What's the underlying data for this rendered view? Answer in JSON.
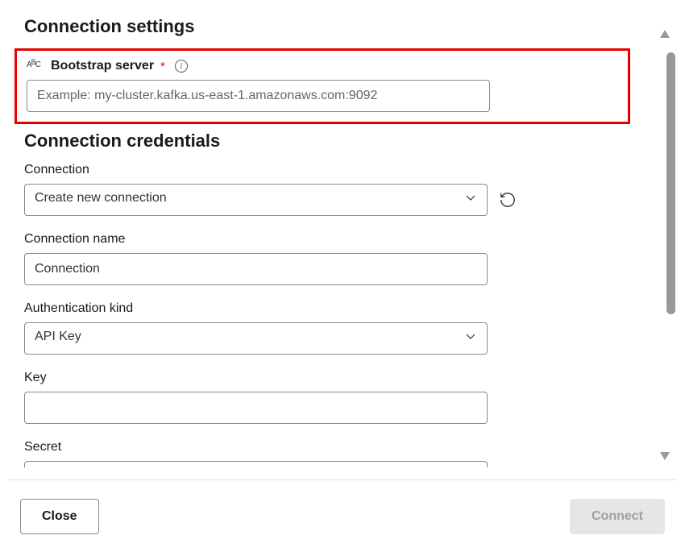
{
  "sections": {
    "settings_heading": "Connection settings",
    "credentials_heading": "Connection credentials"
  },
  "bootstrap": {
    "label": "Bootstrap server",
    "placeholder": "Example: my-cluster.kafka.us-east-1.amazonaws.com:9092",
    "value": ""
  },
  "connection": {
    "label": "Connection",
    "value": "Create new connection"
  },
  "connection_name": {
    "label": "Connection name",
    "value": "Connection"
  },
  "auth_kind": {
    "label": "Authentication kind",
    "value": "API Key"
  },
  "key": {
    "label": "Key",
    "value": ""
  },
  "secret": {
    "label": "Secret",
    "value": ""
  },
  "footer": {
    "close": "Close",
    "connect": "Connect"
  }
}
